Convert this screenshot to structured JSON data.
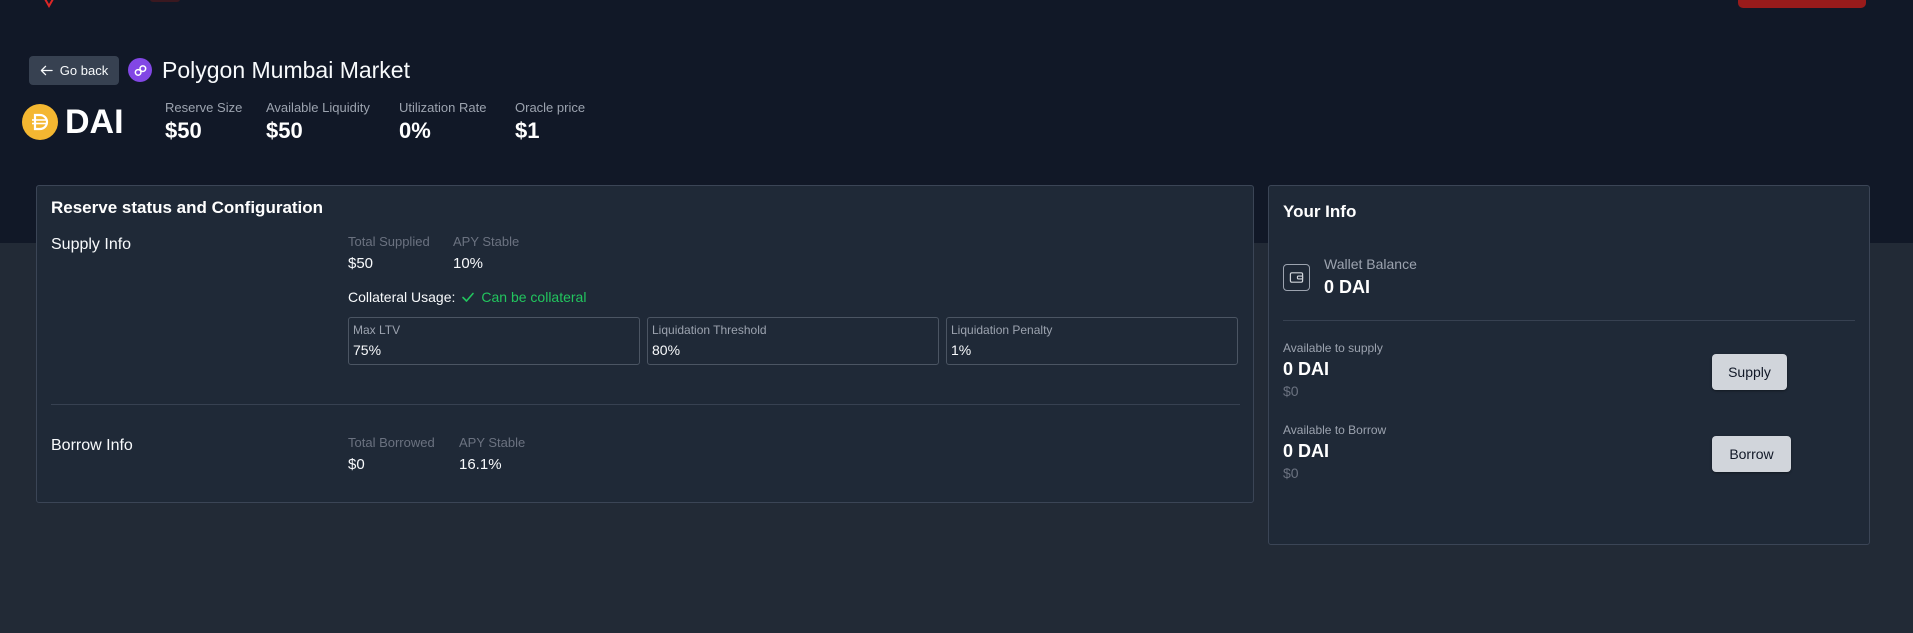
{
  "header": {
    "go_back_label": "Go back",
    "market_title": "Polygon Mumbai Market"
  },
  "asset": {
    "symbol": "DAI",
    "icon": "dai-icon"
  },
  "stats": [
    {
      "label": "Reserve Size",
      "value": "$50"
    },
    {
      "label": "Available Liquidity",
      "value": "$50"
    },
    {
      "label": "Utilization Rate",
      "value": "0%"
    },
    {
      "label": "Oracle price",
      "value": "$1"
    }
  ],
  "reserve": {
    "title": "Reserve status and Configuration",
    "supply": {
      "title": "Supply Info",
      "total_label": "Total Supplied",
      "total_value": "$50",
      "apy_label": "APY Stable",
      "apy_value": "10%",
      "collateral_label": "Collateral Usage:",
      "collateral_status": "Can be collateral",
      "params": [
        {
          "label": "Max LTV",
          "value": "75%"
        },
        {
          "label": "Liquidation Threshold",
          "value": "80%"
        },
        {
          "label": "Liquidation Penalty",
          "value": "1%"
        }
      ]
    },
    "borrow": {
      "title": "Borrow Info",
      "total_label": "Total Borrowed",
      "total_value": "$0",
      "apy_label": "APY Stable",
      "apy_value": "16.1%"
    }
  },
  "your_info": {
    "title": "Your Info",
    "wallet_label": "Wallet Balance",
    "wallet_value": "0 DAI",
    "supply": {
      "label": "Available to supply",
      "value": "0 DAI",
      "usd": "$0",
      "button": "Supply"
    },
    "borrow": {
      "label": "Available to Borrow",
      "value": "0 DAI",
      "usd": "$0",
      "button": "Borrow"
    }
  },
  "colors": {
    "hero_bg": "#111827",
    "page_bg": "#222a36",
    "card_bg": "#1f2937",
    "success": "#22c55e",
    "polygon": "#8247e5",
    "dai": "#f4b731"
  }
}
